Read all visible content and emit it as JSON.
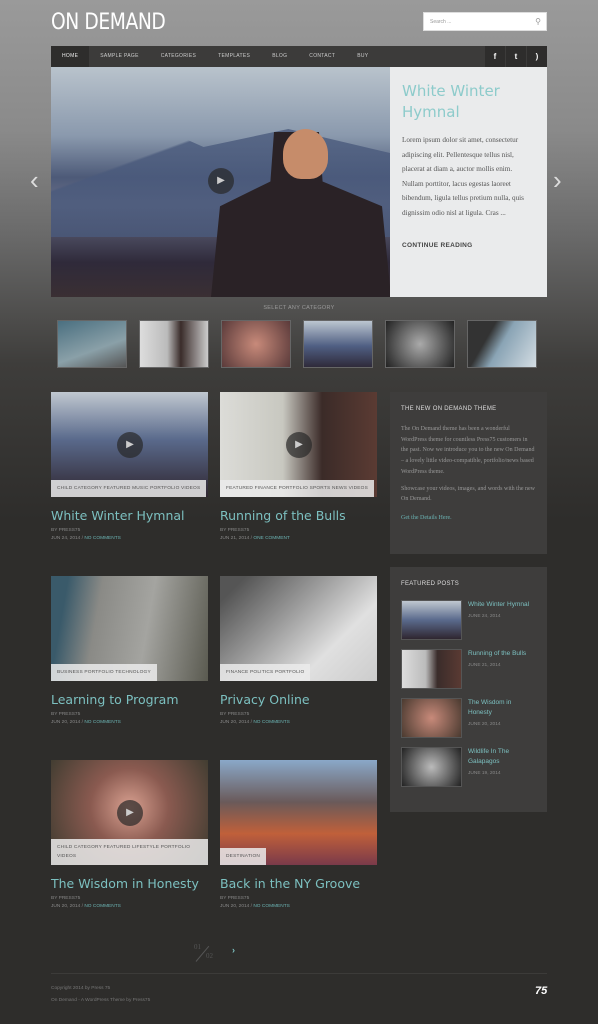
{
  "site": {
    "title": "ON DEMAND",
    "search_placeholder": "Search ..."
  },
  "nav": {
    "items": [
      "HOME",
      "SAMPLE PAGE",
      "CATEGORIES",
      "TEMPLATES",
      "BLOG",
      "CONTACT",
      "BUY"
    ],
    "social": [
      "facebook-icon",
      "twitter-icon",
      "rss-icon"
    ]
  },
  "hero": {
    "title": "White Winter Hymnal",
    "excerpt": "Lorem ipsum dolor sit amet, consectetur adipiscing elit. Pellentesque tellus nisl, placerat at diam a, auctor mollis enim. Nullam porttitor, lacus egestas laoreet bibendum, ligula tellus pretium nulla, quis dignissim odio nisl at ligula. Cras ...",
    "cta": "CONTINUE READING"
  },
  "category_label": "SELECT ANY CATEGORY",
  "posts": [
    {
      "title": "White Winter Hymnal",
      "tags": "CHILD CATEGORY  FEATURED  MUSIC  PORTFOLIO  VIDEOS",
      "by": "BY PRESS75",
      "date": "JUN 24, 2014 / ",
      "comments": "NO COMMENTS",
      "video": true
    },
    {
      "title": "Running of the Bulls",
      "tags": "FEATURED  FINANCE  PORTFOLIO  SPORTS NEWS  VIDEOS",
      "by": "BY PRESS75",
      "date": "JUN 21, 2014 / ",
      "comments": "ONE COMMENT",
      "video": true
    },
    {
      "title": "Learning to Program",
      "tags": "BUSINESS  PORTFOLIO  TECHNOLOGY",
      "by": "BY PRESS75",
      "date": "JUN 20, 2014 / ",
      "comments": "NO COMMENTS",
      "video": false
    },
    {
      "title": "Privacy Online",
      "tags": "FINANCE  POLITICS  PORTFOLIO",
      "by": "BY PRESS75",
      "date": "JUN 20, 2014 / ",
      "comments": "NO COMMENTS",
      "video": false
    },
    {
      "title": "The Wisdom in Honesty",
      "tags": "CHILD CATEGORY  FEATURED  LIFESTYLE  PORTFOLIO  VIDEOS",
      "by": "BY PRESS75",
      "date": "JUN 20, 2014 / ",
      "comments": "NO COMMENTS",
      "video": true
    },
    {
      "title": "Back in the NY Groove",
      "tags": "DESTINATION",
      "by": "BY PRESS75",
      "date": "JUN 20, 2014 / ",
      "comments": "NO COMMENTS",
      "video": false
    }
  ],
  "sidebar": {
    "about": {
      "title": "THE NEW ON DEMAND THEME",
      "p1": "The On Demand theme has been a wonderful WordPress theme for countless Press75 customers in the past. Now we introduce you to the new On Demand – a lovely little video-compatible, portfolio/news based WordPress theme.",
      "p2": "Showcase your videos, images, and words with the new On Demand.",
      "link": "Get the Details Here."
    },
    "featured": {
      "title": "FEATURED POSTS",
      "items": [
        {
          "title": "White Winter Hymnal",
          "date": "JUNE 24, 2014"
        },
        {
          "title": "Running of the Bulls",
          "date": "JUNE 21, 2014"
        },
        {
          "title": "The Wisdom in Honesty",
          "date": "JUNE 20, 2014"
        },
        {
          "title": "Wildlife In The Galapagos",
          "date": "JUNE 19, 2014"
        }
      ]
    }
  },
  "pagination": {
    "current": "01",
    "total": "02"
  },
  "footer": {
    "copyright": "Copyright 2014 by Press 75",
    "credit": "On Demand - A WordPress Theme by Press75",
    "logo": "75"
  },
  "colors": {
    "accent": "#7cc0c0",
    "background": "#2e2d2b"
  }
}
